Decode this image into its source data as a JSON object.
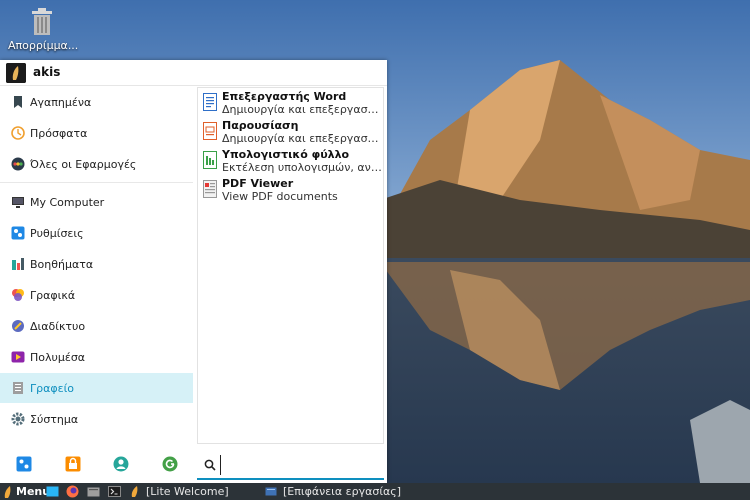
{
  "desktop": {
    "trash_label": "Απορρίμμα..."
  },
  "menu": {
    "username": "akis",
    "categories": [
      {
        "label": "Αγαπημένα",
        "icon": "bookmark-icon"
      },
      {
        "label": "Πρόσφατα",
        "icon": "clock-icon"
      },
      {
        "label": "Όλες οι Εφαρμογές",
        "icon": "apps-icon"
      },
      {
        "label": "My Computer",
        "icon": "monitor-icon"
      },
      {
        "label": "Ρυθμίσεις",
        "icon": "settings-icon"
      },
      {
        "label": "Βοηθήματα",
        "icon": "accessories-icon"
      },
      {
        "label": "Γραφικά",
        "icon": "graphics-icon"
      },
      {
        "label": "Διαδίκτυο",
        "icon": "internet-icon"
      },
      {
        "label": "Πολυμέσα",
        "icon": "multimedia-icon"
      },
      {
        "label": "Γραφείο",
        "icon": "office-icon"
      },
      {
        "label": "Σύστημα",
        "icon": "gear-icon"
      }
    ],
    "active_category": "Γραφείο",
    "apps": [
      {
        "name": "Επεξεργαστής Word",
        "desc": "Δημιουργία και επεξεργασία κειμένου",
        "icon": "document-icon",
        "color": "#2f6fc8"
      },
      {
        "name": "Παρουσίαση",
        "desc": "Δημιουργία και επεξεργασία παρουσιάσεων",
        "icon": "presentation-icon",
        "color": "#e0602a"
      },
      {
        "name": "Υπολογιστικό φύλλο",
        "desc": "Εκτέλεση υπολογισμών, ανάλυση",
        "icon": "spreadsheet-icon",
        "color": "#3aa048"
      },
      {
        "name": "PDF Viewer",
        "desc": "View PDF documents",
        "icon": "pdf-icon",
        "color": "#888888"
      }
    ],
    "search": {
      "value": "",
      "placeholder": ""
    }
  },
  "taskbar": {
    "menu_label": "Menu",
    "tasks": [
      {
        "label": "[Lite Welcome]",
        "icon": "welcome-icon"
      },
      {
        "label": "[Επιφάνεια εργασίας]",
        "icon": "desktop-folder-icon"
      }
    ]
  },
  "colors": {
    "accent": "#0e8fbf",
    "active_bg": "#d6f1f7",
    "taskbar": "#2c3338"
  }
}
